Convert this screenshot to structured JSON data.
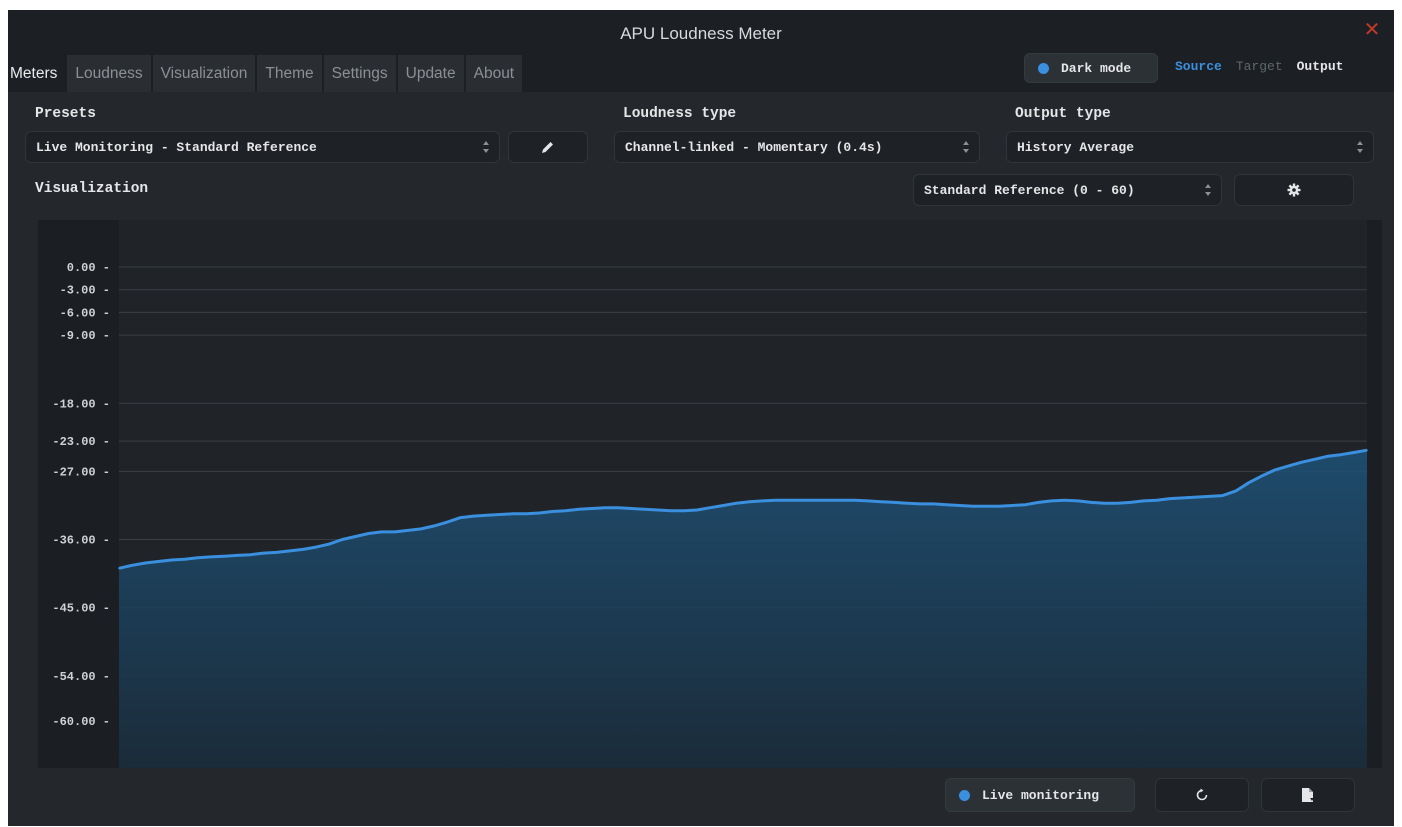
{
  "window": {
    "title": "APU Loudness Meter",
    "close_icon": "close-icon",
    "close_color": "#c0392b"
  },
  "tabs": [
    {
      "label": "Meters",
      "active": true
    },
    {
      "label": "Loudness",
      "active": false
    },
    {
      "label": "Visualization",
      "active": false
    },
    {
      "label": "Theme",
      "active": false
    },
    {
      "label": "Settings",
      "active": false
    },
    {
      "label": "Update",
      "active": false
    },
    {
      "label": "About",
      "active": false
    }
  ],
  "header": {
    "dark_mode_label": "Dark mode",
    "dark_mode_on": true,
    "view_modes": [
      "Source",
      "Target",
      "Output"
    ],
    "active_view_mode": "Source",
    "accent_color": "#3a8fde"
  },
  "controls": {
    "presets": {
      "label": "Presets",
      "value": "Live Monitoring - Standard Reference",
      "edit_icon": "pencil-icon"
    },
    "loudness_type": {
      "label": "Loudness type",
      "value": "Channel-linked - Momentary (0.4s)"
    },
    "output_type": {
      "label": "Output type",
      "value": "History Average"
    },
    "visualization": {
      "label": "Visualization",
      "range_value": "Standard Reference (0 - 60)",
      "settings_icon": "gear-icon"
    }
  },
  "footer": {
    "live_monitoring_label": "Live monitoring",
    "live_monitoring_on": true,
    "reset_icon": "refresh-icon",
    "export_icon": "export-file-icon"
  },
  "chart_data": {
    "type": "area",
    "title": "",
    "xlabel": "",
    "ylabel": "",
    "y_ticks": [
      "0.00",
      "-3.00",
      "-6.00",
      "-9.00",
      "-18.00",
      "-23.00",
      "-27.00",
      "-36.00",
      "-45.00",
      "-54.00",
      "-60.00"
    ],
    "ylim": [
      0,
      -60
    ],
    "grid": true,
    "line_color": "#3a8fde",
    "series": [
      {
        "values": [
          -39.8,
          -39.4,
          -39.1,
          -38.9,
          -38.7,
          -38.6,
          -38.4,
          -38.3,
          -38.2,
          -38.1,
          -38.0,
          -37.8,
          -37.7,
          -37.5,
          -37.3,
          -37.0,
          -36.6,
          -36.0,
          -35.6,
          -35.2,
          -35.0,
          -35.0,
          -34.8,
          -34.6,
          -34.2,
          -33.7,
          -33.1,
          -32.9,
          -32.8,
          -32.7,
          -32.6,
          -32.6,
          -32.5,
          -32.3,
          -32.2,
          -32.0,
          -31.9,
          -31.8,
          -31.8,
          -31.9,
          -32.0,
          -32.1,
          -32.2,
          -32.2,
          -32.1,
          -31.8,
          -31.5,
          -31.2,
          -31.0,
          -30.9,
          -30.8,
          -30.8,
          -30.8,
          -30.8,
          -30.8,
          -30.8,
          -30.8,
          -30.9,
          -31.0,
          -31.1,
          -31.2,
          -31.3,
          -31.3,
          -31.4,
          -31.5,
          -31.6,
          -31.6,
          -31.6,
          -31.5,
          -31.4,
          -31.1,
          -30.9,
          -30.8,
          -30.9,
          -31.1,
          -31.2,
          -31.2,
          -31.1,
          -30.9,
          -30.8,
          -30.6,
          -30.5,
          -30.4,
          -30.3,
          -30.2,
          -29.6,
          -28.5,
          -27.6,
          -26.8,
          -26.3,
          -25.8,
          -25.4,
          -25.0,
          -24.8,
          -24.5,
          -24.2
        ]
      }
    ]
  }
}
